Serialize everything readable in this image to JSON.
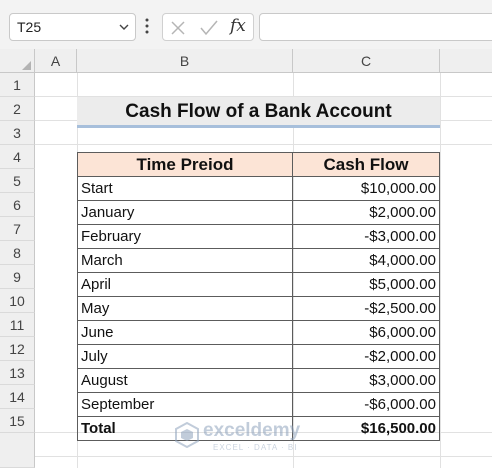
{
  "formula_bar": {
    "name_box": "T25",
    "fx_label": "fx",
    "formula": ""
  },
  "columns": [
    "A",
    "B",
    "C"
  ],
  "rows": [
    "1",
    "2",
    "3",
    "4",
    "5",
    "6",
    "7",
    "8",
    "9",
    "10",
    "11",
    "12",
    "13",
    "14",
    "15"
  ],
  "sheet": {
    "title": "Cash Flow of a Bank Account",
    "headers": {
      "period": "Time Preiod",
      "cash_flow": "Cash Flow"
    },
    "entries": [
      {
        "period": "Start",
        "amount": "$10,000.00"
      },
      {
        "period": "January",
        "amount": "$2,000.00"
      },
      {
        "period": "February",
        "amount": "-$3,000.00"
      },
      {
        "period": "March",
        "amount": "$4,000.00"
      },
      {
        "period": "April",
        "amount": "$5,000.00"
      },
      {
        "period": "May",
        "amount": "-$2,500.00"
      },
      {
        "period": "June",
        "amount": "$6,000.00"
      },
      {
        "period": "July",
        "amount": "-$2,000.00"
      },
      {
        "period": "August",
        "amount": "$3,000.00"
      },
      {
        "period": "September",
        "amount": "-$6,000.00"
      }
    ],
    "total": {
      "label": "Total",
      "amount": "$16,500.00"
    }
  },
  "watermark": {
    "name": "exceldemy",
    "tagline": "EXCEL · DATA · BI"
  },
  "colors": {
    "header_fill": "#fce4d6",
    "title_fill": "#ececec",
    "title_underline": "#a7bfdb"
  }
}
